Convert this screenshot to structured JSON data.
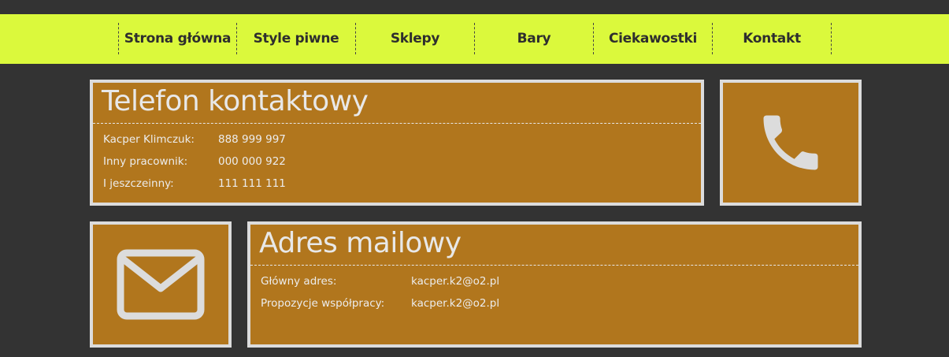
{
  "nav": {
    "items": [
      {
        "label": "Strona główna"
      },
      {
        "label": "Style piwne"
      },
      {
        "label": "Sklepy"
      },
      {
        "label": "Bary"
      },
      {
        "label": "Ciekawostki"
      },
      {
        "label": "Kontakt"
      }
    ]
  },
  "phone_section": {
    "title": "Telefon kontaktowy",
    "rows": [
      {
        "label": "Kacper Klimczuk:",
        "value": "888 999 997"
      },
      {
        "label": "Inny pracownik:",
        "value": "000 000 922"
      },
      {
        "label": "I jeszczeinny:",
        "value": "111 111 111"
      }
    ],
    "icon": "phone-icon"
  },
  "email_section": {
    "title": "Adres mailowy",
    "rows": [
      {
        "label": "Główny adres:",
        "value": "kacper.k2@o2.pl"
      },
      {
        "label": "Propozycje współpracy:",
        "value": "kacper.k2@o2.pl"
      }
    ],
    "icon": "envelope-icon"
  },
  "colors": {
    "background": "#333333",
    "nav_background": "#dbf93c",
    "panel_background": "#b1761d",
    "panel_border": "#dcdcdc"
  }
}
